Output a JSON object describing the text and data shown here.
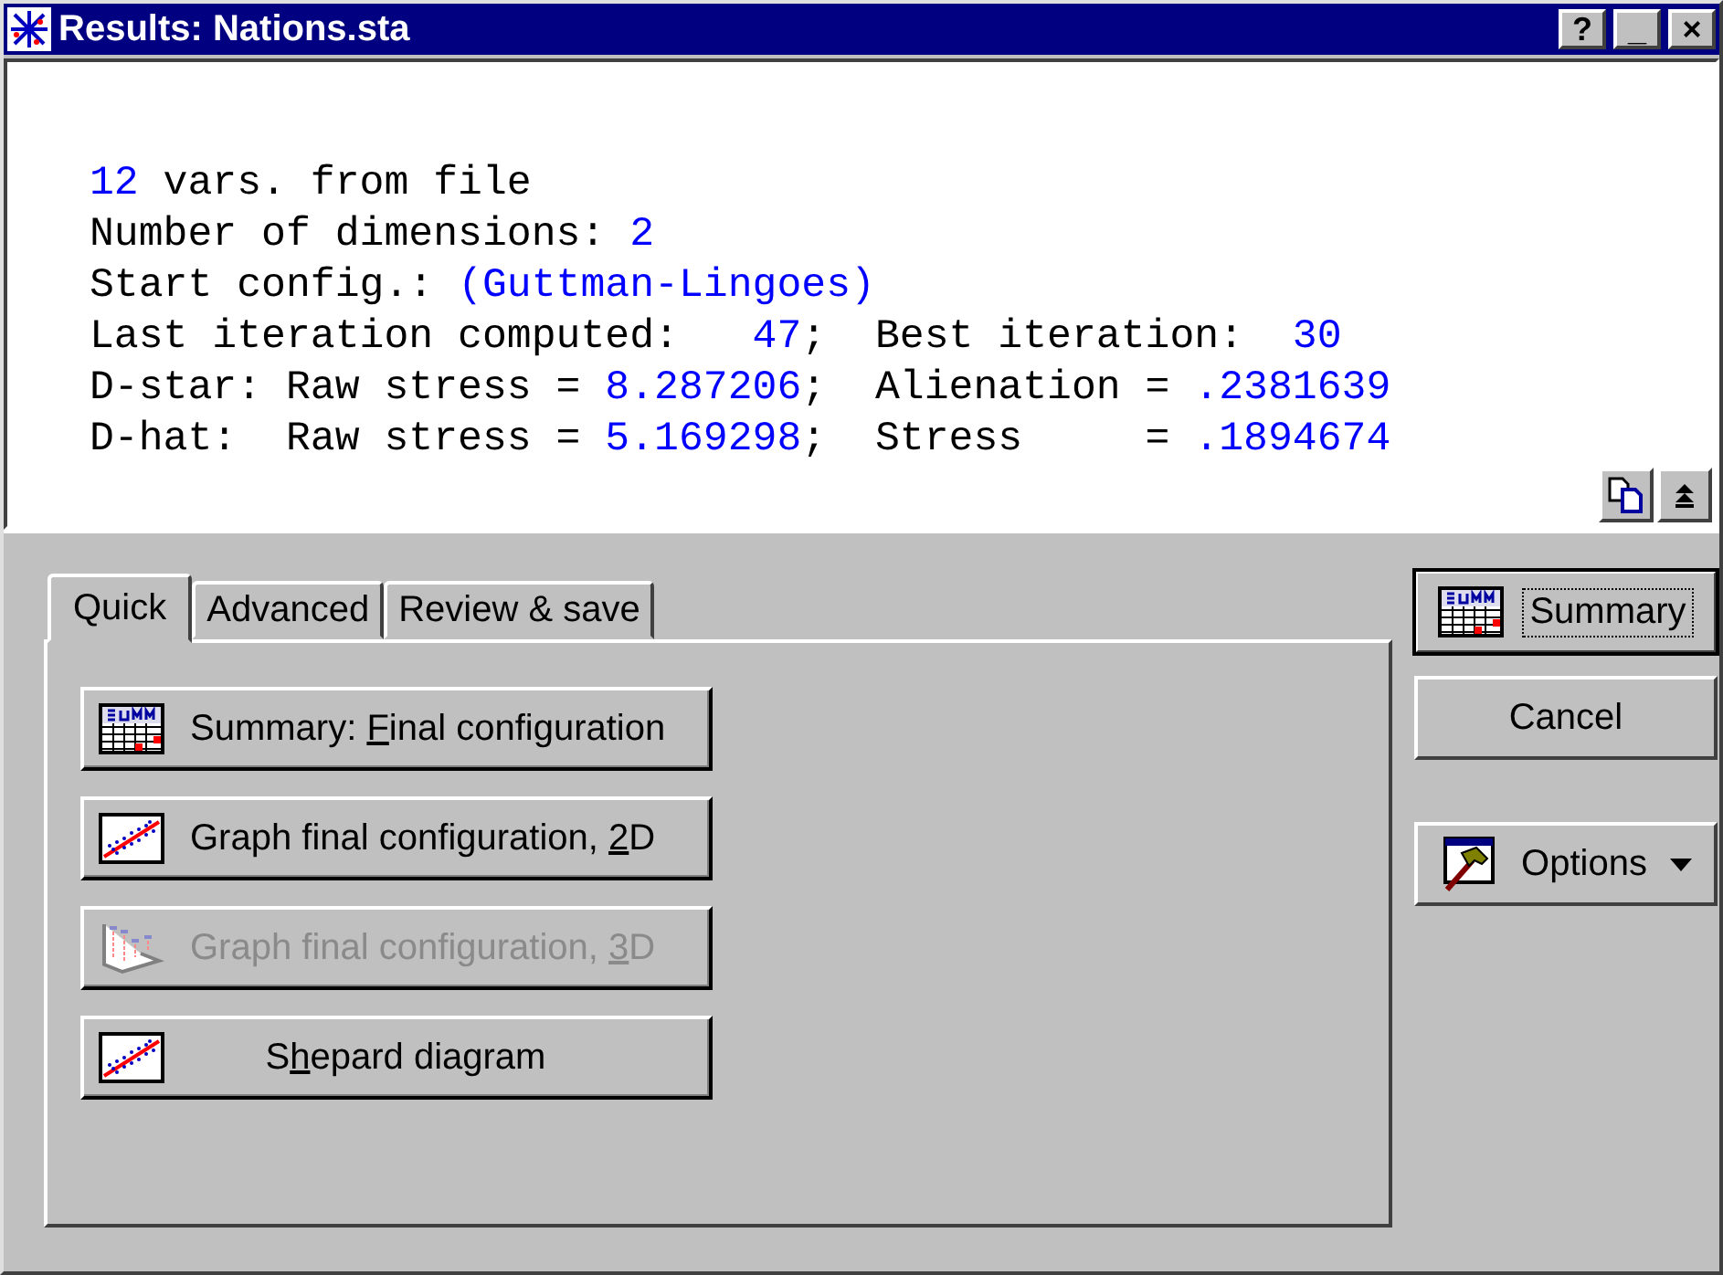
{
  "window": {
    "title": "Results: Nations.sta",
    "controls": [
      "?",
      "_",
      "×"
    ]
  },
  "output": [
    [
      {
        "kind": "value",
        "text": "12"
      },
      {
        "kind": "plain",
        "text": " vars. from file"
      }
    ],
    [
      {
        "kind": "plain",
        "text": "Number of dimensions: "
      },
      {
        "kind": "value",
        "text": "2"
      }
    ],
    [
      {
        "kind": "plain",
        "text": "Start config.: "
      },
      {
        "kind": "value",
        "text": "(Guttman-Lingoes)"
      }
    ],
    [
      {
        "kind": "plain",
        "text": "Last iteration computed:   "
      },
      {
        "kind": "value",
        "text": "47"
      },
      {
        "kind": "plain",
        "text": ";  Best iteration:  "
      },
      {
        "kind": "value",
        "text": "30"
      }
    ],
    [
      {
        "kind": "plain",
        "text": "D-star: Raw stress = "
      },
      {
        "kind": "value",
        "text": "8.287206"
      },
      {
        "kind": "plain",
        "text": ";  Alienation = "
      },
      {
        "kind": "value",
        "text": ".2381639"
      }
    ],
    [
      {
        "kind": "plain",
        "text": "D-hat:  Raw stress = "
      },
      {
        "kind": "value",
        "text": "5.169298"
      },
      {
        "kind": "plain",
        "text": ";  Stress     = "
      },
      {
        "kind": "value",
        "text": ".1894674"
      }
    ]
  ],
  "tabs": [
    {
      "label": "Quick",
      "selected": true
    },
    {
      "label": "Advanced",
      "selected": false
    },
    {
      "label": "Review & save",
      "selected": false
    }
  ],
  "actions": [
    {
      "label": {
        "before": "Summary: ",
        "key": "F",
        "after": "inal configuration"
      },
      "kind": "table",
      "disabled": false,
      "centered": false
    },
    {
      "label": {
        "before": "Graph final configuration, ",
        "key": "2",
        "after": "D"
      },
      "kind": "scatter",
      "disabled": false,
      "centered": false
    },
    {
      "label": {
        "before": "Graph final configuration, ",
        "key": "3",
        "after": "D"
      },
      "kind": "plot3d",
      "disabled": true,
      "centered": false
    },
    {
      "label": {
        "before": "S",
        "key": "h",
        "after": "epard diagram"
      },
      "kind": "scatter",
      "disabled": false,
      "centered": true
    }
  ],
  "side_buttons": [
    {
      "label": "Summary",
      "kind": "table",
      "default": true,
      "dropdown": false
    },
    {
      "label": "Cancel",
      "kind": "plain",
      "default": false,
      "dropdown": false
    },
    {
      "label": "Options",
      "kind": "hammer",
      "default": false,
      "dropdown": true
    }
  ]
}
